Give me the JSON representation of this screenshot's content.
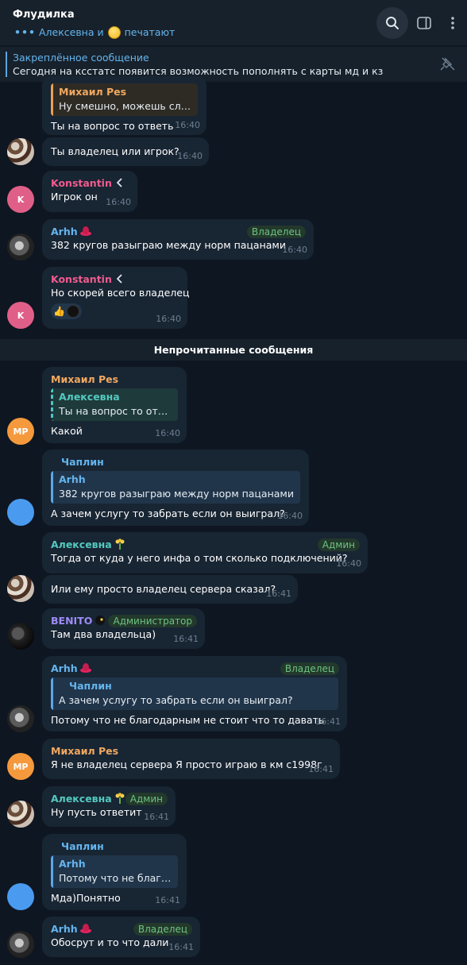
{
  "header": {
    "title": "Флудилка",
    "status_dots": "•••",
    "typing_user": "Алексевна и",
    "typing_suffix": "печатают"
  },
  "pinned": {
    "title": "Закреплённое сообщение",
    "text": "Сегодня на ксстатс появится возможность пополнять с карты мд и кз"
  },
  "unread_label": "Непрочитанные сообщения",
  "messages": [
    {
      "reply_name": "Михаил Pes",
      "reply_text": "Ну смешно, можешь сло...",
      "text": "Ты на вопрос то ответь",
      "time": "16:40"
    },
    {
      "text": "Ты владелец или игрок?",
      "time": "16:40"
    },
    {
      "name": "Konstantin",
      "avatar": "K",
      "text": "Игрок он",
      "time": "16:40"
    },
    {
      "name": "Arhh",
      "role": "Владелец",
      "text": "382 кругов разыграю между норм пацанами",
      "time": "16:40"
    },
    {
      "name": "Konstantin",
      "avatar": "K",
      "text": "Но скорей всего владелец",
      "time": "16:40"
    },
    {
      "name": "Михаил Pes",
      "avatar": "MP",
      "reply_name": "Алексевна",
      "reply_text": "Ты на вопрос то отве...",
      "text": "Какой",
      "time": "16:40"
    },
    {
      "name": "Чаплин",
      "reply_name": "Arhh",
      "reply_text": "382 кругов разыграю между норм пацанами",
      "text": "А зачем услугу то забрать если он выиграл?",
      "time": "16:40"
    },
    {
      "name": "Алексевна",
      "role": "Админ",
      "text": "Тогда от куда у него инфа о том сколько подключений?",
      "time": "16:40"
    },
    {
      "text": "Или ему просто владелец сервера сказал?",
      "time": "16:41"
    },
    {
      "name": "BENITO",
      "role": "Администратор",
      "text": "Там два владельца)",
      "time": "16:41"
    },
    {
      "name": "Arhh",
      "role": "Владелец",
      "reply_name": "Чаплин",
      "reply_text": "А зачем услугу то забрать если он выиграл?",
      "text": "Потому что не благодарным не стоит что то давать",
      "time": "16:41"
    },
    {
      "name": "Михаил Pes",
      "avatar": "MP",
      "text": "Я не владелец сервера Я просто играю в км с1998г",
      "time": "16:41"
    },
    {
      "name": "Алексевна",
      "role": "Админ",
      "text": "Ну пусть ответит",
      "time": "16:41"
    },
    {
      "name": "Чаплин",
      "reply_name": "Arhh",
      "reply_text": "Потому что не благо...",
      "text": "Мда)Понятно",
      "time": "16:41"
    },
    {
      "name": "Arhh",
      "role": "Владелец",
      "text": "Обосрут и то что дали",
      "time": "16:41"
    }
  ]
}
